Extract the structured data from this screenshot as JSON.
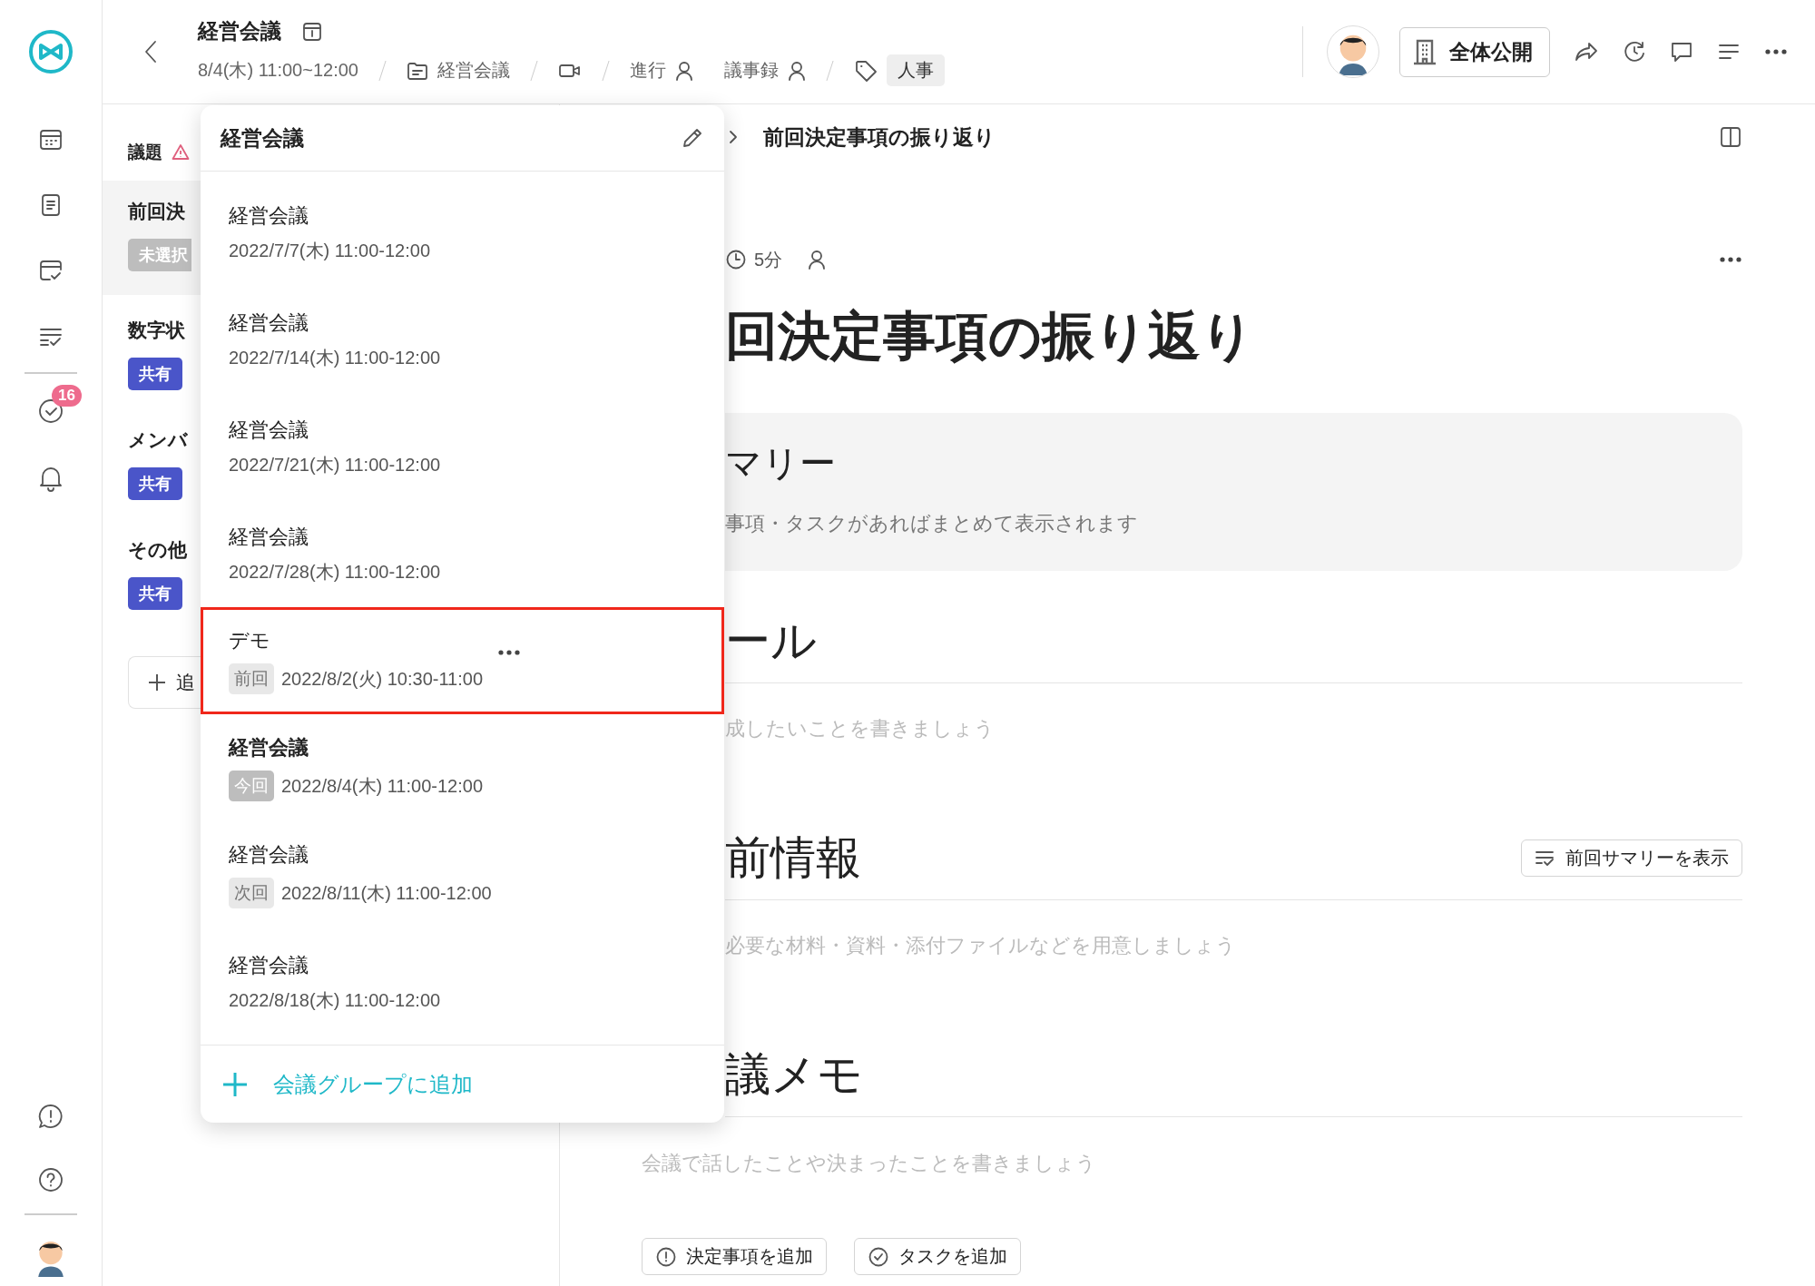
{
  "sidebar": {
    "badge": "16"
  },
  "header": {
    "title": "経営会議",
    "date": "8/4(木) 11:00~12:00",
    "group": "経営会議",
    "facilitator_label": "進行",
    "minutes_label": "議事録",
    "tag": "人事",
    "visibility": "全体公開"
  },
  "agenda": {
    "heading": "議題",
    "items": [
      {
        "title": "前回決",
        "badge": "未選択",
        "kind": "unselected",
        "selected": true
      },
      {
        "title": "数字状",
        "badge": "共有",
        "kind": "shared",
        "selected": false
      },
      {
        "title": "メンバ",
        "badge": "共有",
        "kind": "shared",
        "selected": false
      },
      {
        "title": "その他",
        "badge": "共有",
        "kind": "shared",
        "selected": false
      }
    ],
    "add_button": "追"
  },
  "dropdown": {
    "title": "経営会議",
    "items": [
      {
        "title": "経営会議",
        "date": "2022/7/7(木) 11:00-12:00",
        "selected": false,
        "highlighted": false
      },
      {
        "title": "経営会議",
        "date": "2022/7/14(木) 11:00-12:00",
        "selected": false,
        "highlighted": false
      },
      {
        "title": "経営会議",
        "date": "2022/7/21(木) 11:00-12:00",
        "selected": false,
        "highlighted": false
      },
      {
        "title": "経営会議",
        "date": "2022/7/28(木) 11:00-12:00",
        "selected": false,
        "highlighted": false
      },
      {
        "title": "デモ",
        "tag": "前回",
        "kind": "previous",
        "date": "2022/8/2(火) 10:30-11:00",
        "selected": false,
        "highlighted": true
      },
      {
        "title": "経営会議",
        "tag": "今回",
        "kind": "current",
        "date": "2022/8/4(木) 11:00-12:00",
        "selected": true,
        "highlighted": false
      },
      {
        "title": "経営会議",
        "tag": "次回",
        "kind": "next",
        "date": "2022/8/11(木) 11:00-12:00",
        "selected": false,
        "highlighted": false
      },
      {
        "title": "経営会議",
        "date": "2022/8/18(木) 11:00-12:00",
        "selected": false,
        "highlighted": false
      }
    ],
    "add_label": "会議グループに追加"
  },
  "main": {
    "breadcrumb": "前回決定事項の振り返り",
    "duration": "5分",
    "title": "回決定事項の振り返り",
    "summary": {
      "heading": "マリー",
      "text": "事項・タスクがあればまとめて表示されます"
    },
    "sections": [
      {
        "heading": "ール",
        "placeholder": "成したいことを書きましょう"
      },
      {
        "heading": "前情報",
        "placeholder": "必要な材料・資料・添付ファイルなどを用意しましょう",
        "button": "前回サマリーを表示"
      },
      {
        "heading": "議メモ",
        "placeholder": "会議で話したことや決まったことを書きましょう"
      }
    ],
    "actions": [
      {
        "label": "決定事項を追加",
        "kind": "decision"
      },
      {
        "label": "タスクを追加",
        "kind": "task"
      }
    ]
  }
}
